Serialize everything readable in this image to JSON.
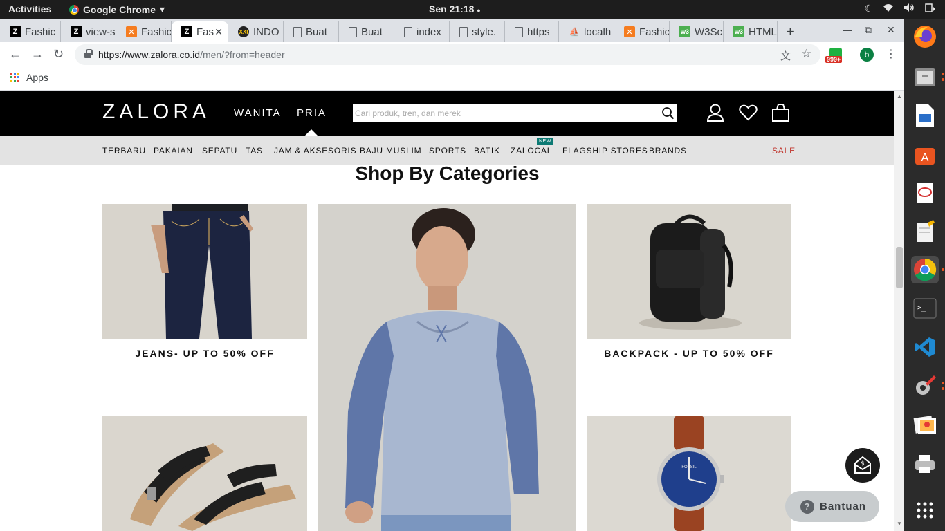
{
  "system": {
    "activities": "Activities",
    "app_name": "Google Chrome",
    "app_menu_caret": "▾",
    "clock": "Sen 21:18",
    "clock_dot": "●"
  },
  "tabs": [
    {
      "title": "Fashic",
      "favicon": "zalora-icon"
    },
    {
      "title": "view-s",
      "favicon": "zalora-icon"
    },
    {
      "title": "Fashic",
      "favicon": "xampp-icon"
    },
    {
      "title": "Fas",
      "favicon": "zalora-icon",
      "active": true
    },
    {
      "title": "INDO",
      "favicon": "xxi-icon"
    },
    {
      "title": "Buat",
      "favicon": "document-icon"
    },
    {
      "title": "Buat",
      "favicon": "document-icon"
    },
    {
      "title": "index",
      "favicon": "document-icon"
    },
    {
      "title": "style.",
      "favicon": "document-icon"
    },
    {
      "title": "https",
      "favicon": "document-icon"
    },
    {
      "title": "localh",
      "favicon": "phpmyadmin-icon"
    },
    {
      "title": "Fashic",
      "favicon": "xampp-icon"
    },
    {
      "title": "W3Sc",
      "favicon": "w3schools-icon"
    },
    {
      "title": "HTML",
      "favicon": "w3schools-icon"
    }
  ],
  "tab_close_glyph": "✕",
  "new_tab_glyph": "+",
  "window_controls": {
    "minimize": "—",
    "restore": "⧉",
    "close": "✕"
  },
  "toolbar": {
    "url_host": "https://www.zalora.co.id",
    "url_path": "/men/?from=header",
    "back_glyph": "←",
    "forward_glyph": "→",
    "reload_glyph": "↻",
    "extension_badge": "999+",
    "profile_initial": "b",
    "menu_glyph": "⋮",
    "star_glyph": "☆",
    "translate_glyph": "文"
  },
  "bookmarks": {
    "apps_label": "Apps"
  },
  "site": {
    "logo": "ZALORA",
    "gender_tabs": [
      "WANITA",
      "PRIA"
    ],
    "search_placeholder": "Cari produk, tren, dan merek",
    "nav_items": [
      "TERBARU",
      "PAKAIAN",
      "SEPATU",
      "TAS",
      "JAM & AKSESORIS",
      "BAJU MUSLIM",
      "SPORTS",
      "BATIK",
      "ZALOCAL",
      "FLAGSHIP STORES",
      "BRANDS"
    ],
    "nav_new_badge": "NEW",
    "sale_label": "SALE",
    "accent_sale": "#c0342c",
    "section_title": "Shop By Categories",
    "categories": [
      {
        "label": "JEANS- UP TO 50% OFF",
        "image": "jeans"
      },
      {
        "label": "",
        "image": "men-raglan-tee"
      },
      {
        "label": "BACKPACK - UP TO 50% OFF",
        "image": "backpack"
      },
      {
        "label": "",
        "image": "sandals"
      },
      {
        "label": "",
        "image": "watch"
      }
    ],
    "watch_brand": "FOSSIL",
    "help_label": "Bantuan",
    "help_glyph": "?"
  }
}
